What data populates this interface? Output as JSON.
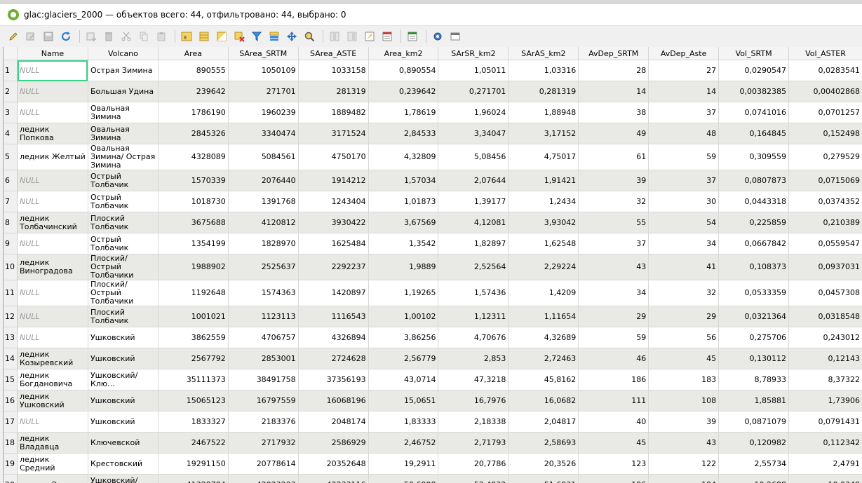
{
  "window": {
    "title": "glac:glaciers_2000 — объектов всего: 44, отфильтровано: 44, выбрано: 0"
  },
  "toolbar": {
    "icons": [
      "toggle-editing-icon",
      "multi-edit-icon",
      "save-edits-icon",
      "reload-icon",
      "add-feature-icon",
      "delete-feature-icon",
      "cut-icon",
      "copy-icon",
      "paste-icon",
      "select-by-expression-icon",
      "select-all-icon",
      "invert-selection-icon",
      "deselect-all-icon",
      "filter-select-icon",
      "move-selection-top-icon",
      "pan-to-selected-icon",
      "zoom-to-selected-icon",
      "new-field-icon",
      "delete-field-icon",
      "field-calculator-icon",
      "conditional-formatting-icon",
      "dock-icon",
      "actions-icon",
      "table-view-icon"
    ]
  },
  "table": {
    "columns": [
      "Name",
      "Volcano",
      "Area",
      "SArea_SRTM",
      "SArea_ASTE",
      "Area_km2",
      "SArSR_km2",
      "SArAS_km2",
      "AvDep_SRTM",
      "AvDep_Aste",
      "Vol_SRTM",
      "Vol_ASTER"
    ],
    "rows": [
      {
        "n": "1",
        "name": "NULL",
        "volcano": "Острая Зимина",
        "v": [
          "890555",
          "1050109",
          "1033158",
          "0,890554",
          "1,05011",
          "1,03316",
          "28",
          "27",
          "0,0290547",
          "0,0283541"
        ]
      },
      {
        "n": "2",
        "name": "NULL",
        "volcano": "Большая Удина",
        "v": [
          "239642",
          "271701",
          "281319",
          "0,239642",
          "0,271701",
          "0,281319",
          "14",
          "14",
          "0,00382385",
          "0,00402868"
        ]
      },
      {
        "n": "3",
        "name": "NULL",
        "volcano": "Овальная Зимина",
        "v": [
          "1786190",
          "1960239",
          "1889482",
          "1,78619",
          "1,96024",
          "1,88948",
          "38",
          "37",
          "0,0741016",
          "0,0701257"
        ]
      },
      {
        "n": "4",
        "name": "ледник Попкова",
        "volcano": "Овальная Зимина",
        "v": [
          "2845326",
          "3340474",
          "3171524",
          "2,84533",
          "3,34047",
          "3,17152",
          "49",
          "48",
          "0,164845",
          "0,152498"
        ]
      },
      {
        "n": "5",
        "name": "ледник Желтый",
        "volcano": "Овальная Зимина/ Острая Зимина",
        "v": [
          "4328089",
          "5084561",
          "4750170",
          "4,32809",
          "5,08456",
          "4,75017",
          "61",
          "59",
          "0,309559",
          "0,279529"
        ]
      },
      {
        "n": "6",
        "name": "NULL",
        "volcano": "Острый Толбачик",
        "v": [
          "1570339",
          "2076440",
          "1914212",
          "1,57034",
          "2,07644",
          "1,91421",
          "39",
          "37",
          "0,0807873",
          "0,0715069"
        ]
      },
      {
        "n": "7",
        "name": "NULL",
        "volcano": "Острый Толбачик",
        "v": [
          "1018730",
          "1391768",
          "1243404",
          "1,01873",
          "1,39177",
          "1,2434",
          "32",
          "30",
          "0,0443318",
          "0,0374352"
        ]
      },
      {
        "n": "8",
        "name": "ледник Толбачинский",
        "volcano": "Плоский Толбачик",
        "v": [
          "3675688",
          "4120812",
          "3930422",
          "3,67569",
          "4,12081",
          "3,93042",
          "55",
          "54",
          "0,225859",
          "0,210389"
        ]
      },
      {
        "n": "9",
        "name": "NULL",
        "volcano": "Острый Толбачик",
        "v": [
          "1354199",
          "1828970",
          "1625484",
          "1,3542",
          "1,82897",
          "1,62548",
          "37",
          "34",
          "0,0667842",
          "0,0559547"
        ]
      },
      {
        "n": "10",
        "name": "ледник Виноградова",
        "volcano": "Плоский/Острый Толбачики",
        "v": [
          "1988902",
          "2525637",
          "2292237",
          "1,9889",
          "2,52564",
          "2,29224",
          "43",
          "41",
          "0,108373",
          "0,0937031"
        ]
      },
      {
        "n": "11",
        "name": "NULL",
        "volcano": "Плоский/Острый Толбачики",
        "v": [
          "1192648",
          "1574363",
          "1420897",
          "1,19265",
          "1,57436",
          "1,4209",
          "34",
          "32",
          "0,0533359",
          "0,0457308"
        ]
      },
      {
        "n": "12",
        "name": "NULL",
        "volcano": "Плоский Толбачик",
        "v": [
          "1001021",
          "1123113",
          "1116543",
          "1,00102",
          "1,12311",
          "1,11654",
          "29",
          "29",
          "0,0321364",
          "0,0318548"
        ]
      },
      {
        "n": "13",
        "name": "NULL",
        "volcano": "Ушковский",
        "v": [
          "3862559",
          "4706757",
          "4326894",
          "3,86256",
          "4,70676",
          "4,32689",
          "59",
          "56",
          "0,275706",
          "0,243012"
        ]
      },
      {
        "n": "14",
        "name": "ледник Козыревский",
        "volcano": "Ушковский",
        "v": [
          "2567792",
          "2853001",
          "2724628",
          "2,56779",
          "2,853",
          "2,72463",
          "46",
          "45",
          "0,130112",
          "0,12143"
        ]
      },
      {
        "n": "15",
        "name": "ледник Богдановича",
        "volcano": "Ушковский/Клю…",
        "v": [
          "35111373",
          "38491758",
          "37356193",
          "43,0714",
          "47,3218",
          "45,8162",
          "186",
          "183",
          "8,78933",
          "8,37322"
        ]
      },
      {
        "n": "16",
        "name": "ледник Ушковский",
        "volcano": "Ушковский",
        "v": [
          "15065123",
          "16797559",
          "16068196",
          "15,0651",
          "16,7976",
          "16,0682",
          "111",
          "108",
          "1,85881",
          "1,73906"
        ]
      },
      {
        "n": "17",
        "name": "NULL",
        "volcano": "Ушковский",
        "v": [
          "1833327",
          "2183376",
          "2048174",
          "1,83333",
          "2,18338",
          "2,04817",
          "40",
          "39",
          "0,0871079",
          "0,0791431"
        ]
      },
      {
        "n": "18",
        "name": "ледник Владавца",
        "volcano": "Ключевской",
        "v": [
          "2467522",
          "2717932",
          "2586929",
          "2,46752",
          "2,71793",
          "2,58693",
          "45",
          "43",
          "0,120982",
          "0,112342"
        ]
      },
      {
        "n": "19",
        "name": "ледник Средний",
        "volcano": "Крестовский",
        "v": [
          "19291150",
          "20778614",
          "20352648",
          "19,2911",
          "20,7786",
          "20,3526",
          "123",
          "122",
          "2,55734",
          "2,4791"
        ]
      },
      {
        "n": "20",
        "name": "ледник Эрмана",
        "volcano": "Ушковский/ Ключевской",
        "v": [
          "41329784",
          "42923203",
          "42233116",
          "50,6998",
          "52,4932",
          "51,6931",
          "196",
          "194",
          "10,2688",
          "10,0349"
        ]
      }
    ]
  }
}
